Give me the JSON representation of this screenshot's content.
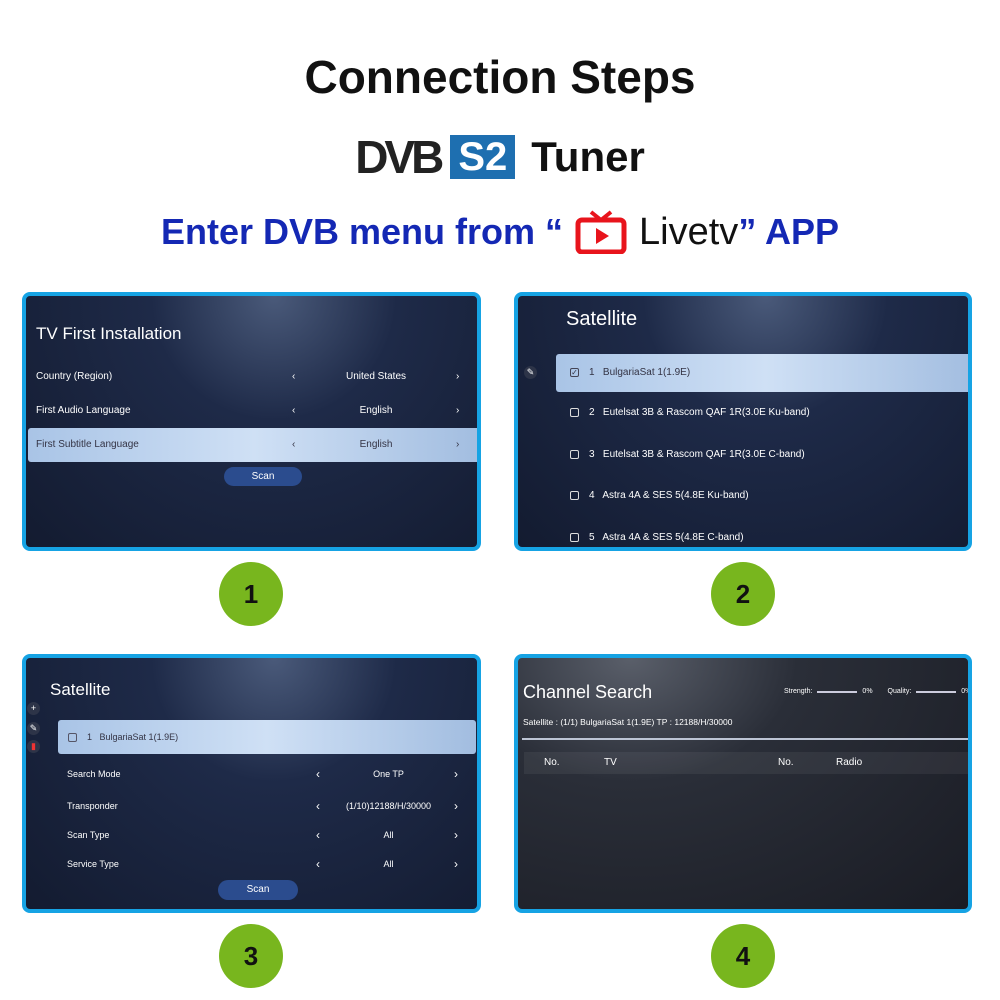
{
  "header": {
    "title": "Connection Steps",
    "dvb_logo": "DVB",
    "s2_badge": "S2",
    "tuner": "Tuner",
    "enter_prefix": "Enter DVB menu from “",
    "app_name": "Livetv",
    "enter_suffix": "” APP"
  },
  "colors": {
    "panel_border": "#16a3e4",
    "step_circle": "#78b61e",
    "heading_blue": "#1428b4",
    "livetv_red": "#e8141c",
    "s2_blue": "#1e6fb0"
  },
  "steps": [
    "1",
    "2",
    "3",
    "4"
  ],
  "panel1": {
    "title": "TV First Installation",
    "rows": [
      {
        "label": "Country (Region)",
        "value": "United States"
      },
      {
        "label": "First Audio Language",
        "value": "English"
      },
      {
        "label": "First Subtitle Language",
        "value": "English",
        "selected": true
      }
    ],
    "scan": "Scan"
  },
  "panel2": {
    "title": "Satellite",
    "items": [
      {
        "no": "1",
        "name": "BulgariaSat 1(1.9E)",
        "checked": true
      },
      {
        "no": "2",
        "name": "Eutelsat 3B & Rascom QAF 1R(3.0E Ku-band)"
      },
      {
        "no": "3",
        "name": "Eutelsat 3B & Rascom QAF 1R(3.0E C-band)"
      },
      {
        "no": "4",
        "name": "Astra 4A & SES 5(4.8E Ku-band)"
      },
      {
        "no": "5",
        "name": "Astra 4A & SES 5(4.8E C-band)"
      }
    ]
  },
  "panel3": {
    "title": "Satellite",
    "item": {
      "no": "1",
      "name": "BulgariaSat 1(1.9E)"
    },
    "rows": [
      {
        "label": "Search Mode",
        "value": "One TP"
      },
      {
        "label": "Transponder",
        "value": "(1/10)12188/H/30000"
      },
      {
        "label": "Scan Type",
        "value": "All"
      },
      {
        "label": "Service Type",
        "value": "All"
      }
    ],
    "scan": "Scan"
  },
  "panel4": {
    "title": "Channel Search",
    "strength_label": "Strength:",
    "strength": "0%",
    "quality_label": "Quality:",
    "quality": "0%",
    "info": "Satellite : (1/1) BulgariaSat 1(1.9E)  TP : 12188/H/30000",
    "cols": [
      "No.",
      "TV",
      "No.",
      "Radio"
    ]
  }
}
